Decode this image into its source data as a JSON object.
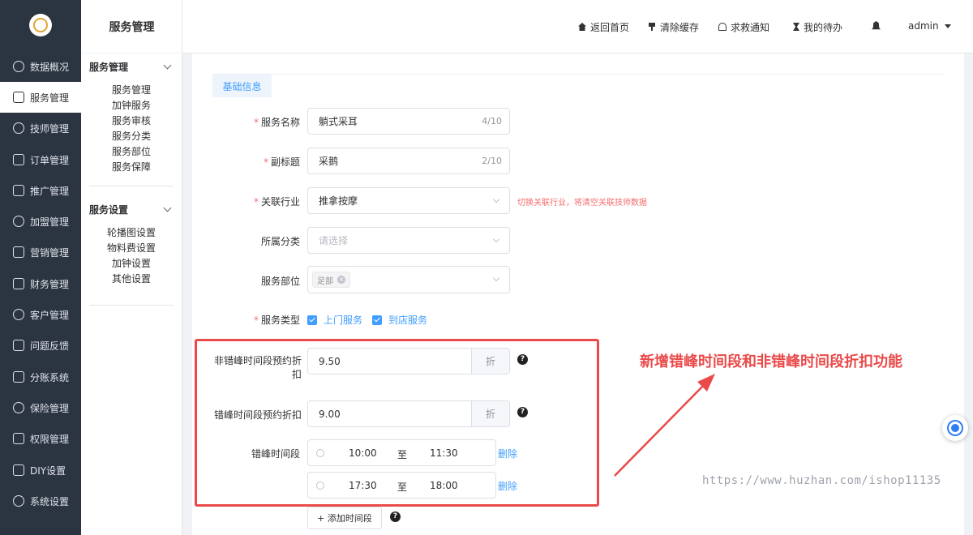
{
  "main_nav": [
    {
      "label": "数据概况",
      "icon": "pie-chart-icon"
    },
    {
      "label": "服务管理",
      "icon": "service-icon",
      "active": true
    },
    {
      "label": "技师管理",
      "icon": "technician-icon"
    },
    {
      "label": "订单管理",
      "icon": "order-icon"
    },
    {
      "label": "推广管理",
      "icon": "promotion-icon"
    },
    {
      "label": "加盟管理",
      "icon": "franchise-icon"
    },
    {
      "label": "营销管理",
      "icon": "marketing-icon"
    },
    {
      "label": "财务管理",
      "icon": "finance-icon"
    },
    {
      "label": "客户管理",
      "icon": "customer-icon"
    },
    {
      "label": "问题反馈",
      "icon": "feedback-icon"
    },
    {
      "label": "分账系统",
      "icon": "split-account-icon"
    },
    {
      "label": "保险管理",
      "icon": "shield-icon"
    },
    {
      "label": "权限管理",
      "icon": "permission-icon"
    },
    {
      "label": "DIY设置",
      "icon": "diy-icon"
    },
    {
      "label": "系统设置",
      "icon": "gear-icon"
    }
  ],
  "subnav": {
    "title": "服务管理",
    "groups": [
      {
        "label": "服务管理",
        "items": [
          "服务管理",
          "加钟服务",
          "服务审核",
          "服务分类",
          "服务部位",
          "服务保障"
        ]
      },
      {
        "label": "服务设置",
        "items": [
          "轮播图设置",
          "物料费设置",
          "加钟设置",
          "其他设置"
        ]
      }
    ]
  },
  "header": {
    "home": "返回首页",
    "clear_cache": "清除缓存",
    "rescue": "求救通知",
    "todo": "我的待办",
    "user": "admin"
  },
  "form": {
    "tab": "基础信息",
    "name": {
      "label": "服务名称",
      "value": "躺式采耳",
      "count": "4/10"
    },
    "subtitle": {
      "label": "副标题",
      "value": "采鹅",
      "count": "2/10"
    },
    "industry": {
      "label": "关联行业",
      "value": "推拿按摩",
      "warning": "切换关联行业，将清空关联技师数据"
    },
    "category": {
      "label": "所属分类",
      "placeholder": "请选择"
    },
    "body_part": {
      "label": "服务部位",
      "tag": "足部"
    },
    "service_type": {
      "label": "服务类型",
      "options": [
        "上门服务",
        "到店服务"
      ]
    },
    "offpeak": {
      "label": "非错峰时间段预约折扣",
      "value": "9.50",
      "unit": "折"
    },
    "peak": {
      "label": "错峰时间段预约折扣",
      "value": "9.00",
      "unit": "折"
    },
    "peak_periods": {
      "label": "错峰时间段",
      "sep": "至",
      "delete": "删除",
      "ranges": [
        {
          "start": "10:00",
          "end": "11:30"
        },
        {
          "start": "17:30",
          "end": "18:00"
        }
      ]
    },
    "add_period": "+ 添加时间段",
    "help": "?"
  },
  "annotation": "新增错峰时间段和非错峰时间段折扣功能",
  "watermark": "https://www.huzhan.com/ishop11135",
  "colors": {
    "accent": "#409eff",
    "danger": "#f56c6c",
    "nav_bg": "#2b3441",
    "annotation": "#ea4a4a"
  }
}
